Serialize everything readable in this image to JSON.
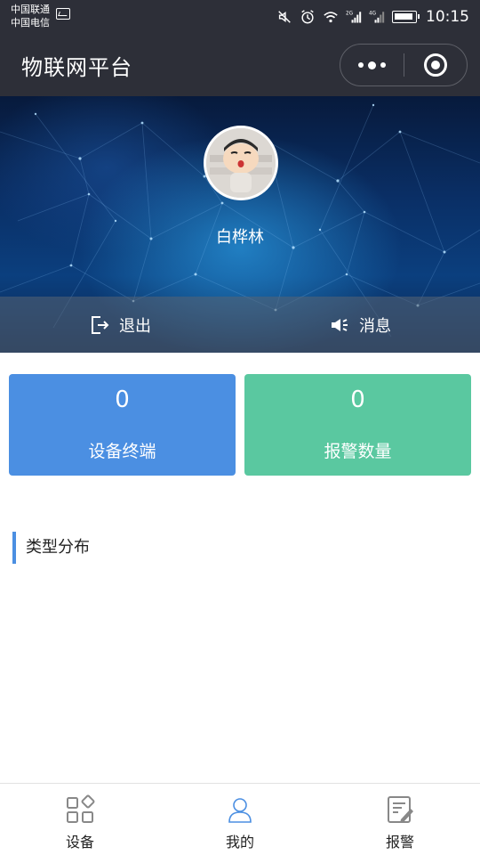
{
  "status_bar": {
    "carrier_1": "中国联通",
    "carrier_2": "中国电信",
    "signal_1_label": "2G",
    "signal_2_label": "4G",
    "time": "10:15",
    "icons": [
      "mute-icon",
      "alarm-icon",
      "wifi-icon",
      "signal-icon",
      "signal-icon",
      "battery-icon"
    ]
  },
  "title_bar": {
    "title": "物联网平台",
    "more_icon": "more-dots-icon",
    "close_icon": "target-close-icon"
  },
  "profile": {
    "name": "白桦林",
    "actions": [
      {
        "label": "退出",
        "icon": "logout-icon"
      },
      {
        "label": "消息",
        "icon": "speaker-icon"
      }
    ]
  },
  "stats": [
    {
      "value": "0",
      "label": "设备终端",
      "color": "#4b8fe2"
    },
    {
      "value": "0",
      "label": "报警数量",
      "color": "#5ac8a0"
    }
  ],
  "section": {
    "title": "类型分布",
    "accent": "#4b8fe2"
  },
  "tab_bar": {
    "active_color": "#4b8fe2",
    "items": [
      {
        "label": "设备",
        "icon": "grid-icon",
        "active": false
      },
      {
        "label": "我的",
        "icon": "user-icon",
        "active": true
      },
      {
        "label": "报警",
        "icon": "edit-document-icon",
        "active": false
      }
    ]
  }
}
